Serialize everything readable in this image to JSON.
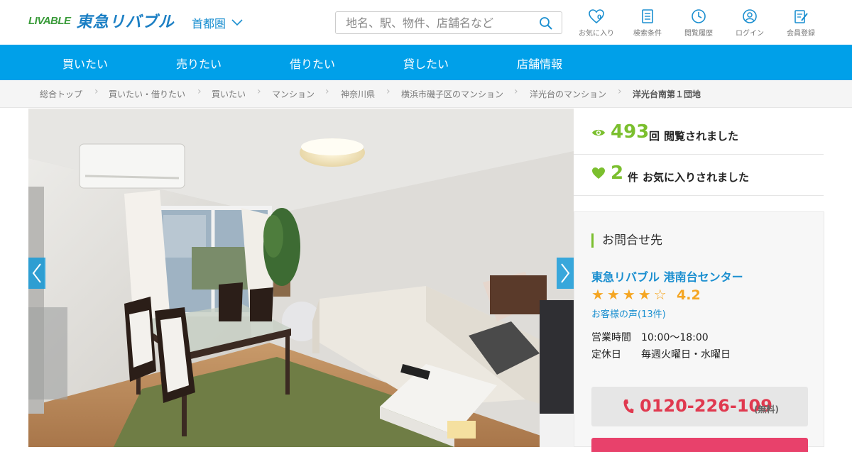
{
  "header": {
    "logo_mark": "LIVABLE",
    "logo_text": "東急リバブル",
    "region": "首都圏",
    "search_placeholder": "地名、駅、物件、店舗名など",
    "favorites_count": "0",
    "nav": [
      {
        "label": "お気に入り",
        "icon": "heart-icon"
      },
      {
        "label": "検索条件",
        "icon": "document-icon"
      },
      {
        "label": "閲覧履歴",
        "icon": "clock-icon"
      },
      {
        "label": "ログイン",
        "icon": "user-icon"
      },
      {
        "label": "会員登録",
        "icon": "pen-icon"
      }
    ]
  },
  "main_nav": [
    "買いたい",
    "売りたい",
    "借りたい",
    "貸したい",
    "店舗情報"
  ],
  "breadcrumb": [
    "総合トップ",
    "買いたい・借りたい",
    "買いたい",
    "マンション",
    "神奈川県",
    "横浜市磯子区のマンション",
    "洋光台のマンション",
    "洋光台南第１団地"
  ],
  "stats": {
    "views": {
      "count": "493",
      "unit": "回",
      "text": "閲覧されました"
    },
    "favorites": {
      "count": "2",
      "unit": "件",
      "text": "お気に入りされました"
    }
  },
  "contact": {
    "title": "お問合せ先",
    "store_name": "東急リバブル 港南台センター",
    "stars": "★★★★☆",
    "rating": "4.2",
    "rating_value": 4.2,
    "voices_link": "お客様の声(13件)",
    "hours_label": "営業時間",
    "hours_value": "10:00～18:00",
    "holiday_label": "定休日",
    "holiday_value": "毎週火曜日・水曜日",
    "phone": "0120-226-109",
    "phone_note": "(無料)"
  },
  "colors": {
    "brand_blue": "#00a0e9",
    "link_blue": "#1b8fd0",
    "green": "#7bbf2e",
    "star": "#f5a623",
    "phone_red": "#e0394f"
  }
}
